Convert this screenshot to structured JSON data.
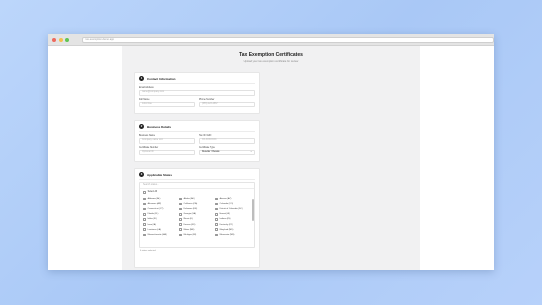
{
  "browser": {
    "url": "tax-exemption.demo.app",
    "controls": {
      "close_color": "#ee6a5e",
      "min_color": "#f5bf4f",
      "max_color": "#61c554"
    }
  },
  "page": {
    "title": "Tax Exemption Certificates",
    "subtitle": "Upload your tax exemption certificate for review"
  },
  "contact": {
    "number": "1",
    "title": "Contact Information",
    "email_label": "Email Address",
    "email_placeholder": "name@company.com",
    "first_name_label": "Full Name",
    "first_name_placeholder": "John Doe",
    "phone_label": "Phone Number",
    "phone_placeholder": "(555) 123-4567"
  },
  "business": {
    "number": "2",
    "title": "Business Details",
    "name_label": "Business Name",
    "name_placeholder": "Company name LLC",
    "taxid_label": "Tax ID / EIN",
    "taxid_placeholder": "XX-XXXXXXX",
    "cert_label": "Certificate Number",
    "cert_placeholder": "Optional ID",
    "certtype_label": "Certificate Type",
    "certtype_value": "Reseller / Resale"
  },
  "states_section": {
    "number": "3",
    "title": "Applicable States",
    "search_placeholder": "Search states...",
    "select_all": "Select All",
    "footnote": "0 states selected",
    "states": [
      "Alabama (AL)",
      "Alaska (AK)",
      "Arizona (AZ)",
      "Arkansas (AR)",
      "California (CA)",
      "Colorado (CO)",
      "Connecticut (CT)",
      "Delaware (DE)",
      "District of Columbia (DC)",
      "Florida (FL)",
      "Georgia (GA)",
      "Hawaii (HI)",
      "Idaho (ID)",
      "Illinois (IL)",
      "Indiana (IN)",
      "Iowa (IA)",
      "Kansas (KS)",
      "Kentucky (KY)",
      "Louisiana (LA)",
      "Maine (ME)",
      "Maryland (MD)",
      "Massachusetts (MA)",
      "Michigan (MI)",
      "Minnesota (MN)"
    ]
  }
}
